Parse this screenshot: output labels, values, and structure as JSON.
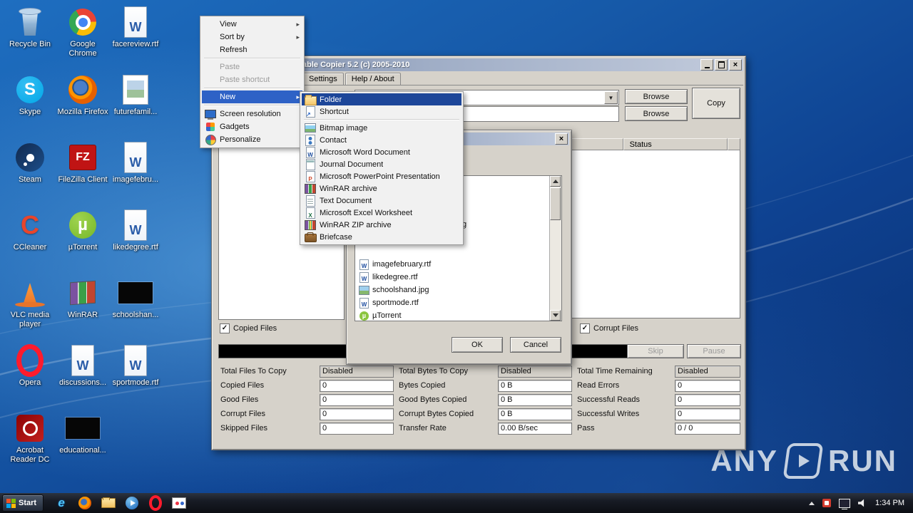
{
  "colors": {
    "selection_blue": "#2e62c6",
    "submenu_selection_blue": "#1d4699",
    "desktop_blue": "#1659a8",
    "window_gray": "#d6d2ca",
    "taskbar_dark": "#14161c"
  },
  "desktop": {
    "icons": [
      {
        "label": "Recycle Bin",
        "type": "recycle",
        "col": 0,
        "row": 0
      },
      {
        "label": "Google Chrome",
        "type": "chrome",
        "col": 1,
        "row": 0
      },
      {
        "label": "facereview.rtf",
        "type": "doc",
        "glyph": "W",
        "col": 2,
        "row": 0
      },
      {
        "label": "Skype",
        "type": "skype",
        "col": 0,
        "row": 1
      },
      {
        "label": "Mozilla Firefox",
        "type": "firefox",
        "col": 1,
        "row": 1
      },
      {
        "label": "futurefamil...",
        "type": "imgfile",
        "col": 2,
        "row": 1
      },
      {
        "label": "Steam",
        "type": "steam",
        "col": 0,
        "row": 2
      },
      {
        "label": "FileZilla Client",
        "type": "filezilla",
        "col": 1,
        "row": 2
      },
      {
        "label": "imagefebru...",
        "type": "doc",
        "glyph": "W",
        "col": 2,
        "row": 2
      },
      {
        "label": "CCleaner",
        "type": "ccleaner",
        "col": 0,
        "row": 3
      },
      {
        "label": "µTorrent",
        "type": "utorrent",
        "col": 1,
        "row": 3
      },
      {
        "label": "likedegree.rtf",
        "type": "doc",
        "glyph": "W",
        "col": 2,
        "row": 3
      },
      {
        "label": "VLC media player",
        "type": "vlc",
        "col": 0,
        "row": 4
      },
      {
        "label": "WinRAR",
        "type": "winrar",
        "col": 1,
        "row": 4
      },
      {
        "label": "schoolshan...",
        "type": "blackthumb",
        "col": 2,
        "row": 4
      },
      {
        "label": "Opera",
        "type": "opera",
        "col": 0,
        "row": 5
      },
      {
        "label": "discussions...",
        "type": "doc",
        "glyph": "W",
        "col": 1,
        "row": 5
      },
      {
        "label": "sportmode.rtf",
        "type": "doc",
        "glyph": "W",
        "col": 2,
        "row": 5
      },
      {
        "label": "Acrobat Reader DC",
        "type": "acrobat",
        "col": 0,
        "row": 6
      },
      {
        "label": "educational...",
        "type": "blackthumb",
        "col": 1,
        "row": 6
      }
    ]
  },
  "context_menu": {
    "items": [
      {
        "label": "View",
        "submenu": true
      },
      {
        "label": "Sort by",
        "submenu": true
      },
      {
        "label": "Refresh"
      },
      {
        "sep": true
      },
      {
        "label": "Paste",
        "disabled": true
      },
      {
        "label": "Paste shortcut",
        "disabled": true
      },
      {
        "sep": true
      },
      {
        "label": "New",
        "submenu": true,
        "selected": true
      },
      {
        "sep": true
      },
      {
        "label": "Screen resolution",
        "icon": "screen"
      },
      {
        "label": "Gadgets",
        "icon": "gadgets"
      },
      {
        "label": "Personalize",
        "icon": "personalize"
      }
    ]
  },
  "new_submenu": {
    "items": [
      {
        "label": "Folder",
        "icon": "folder",
        "selected": true
      },
      {
        "label": "Shortcut",
        "icon": "shortcut"
      },
      {
        "sep": true
      },
      {
        "label": "Bitmap image",
        "icon": "bitmap"
      },
      {
        "label": "Contact",
        "icon": "contact"
      },
      {
        "label": "Microsoft Word Document",
        "icon": "word",
        "glyph": "W"
      },
      {
        "label": "Journal Document",
        "icon": "journal"
      },
      {
        "label": "Microsoft PowerPoint Presentation",
        "icon": "powerpoint",
        "glyph": "P"
      },
      {
        "label": "WinRAR archive",
        "icon": "rar"
      },
      {
        "label": "Text Document",
        "icon": "text"
      },
      {
        "label": "Microsoft Excel Worksheet",
        "icon": "excel",
        "glyph": "X"
      },
      {
        "label": "WinRAR ZIP archive",
        "icon": "zip"
      },
      {
        "label": "Briefcase",
        "icon": "briefcase"
      }
    ]
  },
  "app_window": {
    "title": "able Copier 5.2 (c) 2005-2010",
    "tabs": [
      "Settings",
      "Help / About"
    ],
    "browse_top": "Browse",
    "browse_bottom": "Browse",
    "copy": "Copy",
    "status_column": "Status",
    "copied_files": "Copied Files",
    "corrupt_files": "Corrupt Files",
    "skip": "Skip",
    "pause": "Pause",
    "stats": {
      "files": [
        {
          "label": "Total Files To Copy",
          "value": "Disabled"
        },
        {
          "label": "Copied Files",
          "value": "0"
        },
        {
          "label": "Good Files",
          "value": "0"
        },
        {
          "label": "Corrupt Files",
          "value": "0"
        },
        {
          "label": "Skipped Files",
          "value": "0"
        }
      ],
      "bytes": [
        {
          "label": "Total Bytes To Copy",
          "value": "Disabled"
        },
        {
          "label": "Bytes Copied",
          "value": "0 B"
        },
        {
          "label": "Good Bytes Copied",
          "value": "0 B"
        },
        {
          "label": "Corrupt Bytes Copied",
          "value": "0 B"
        },
        {
          "label": "Transfer Rate",
          "value": "0.00 B/sec"
        }
      ],
      "time": [
        {
          "label": "Total Time Remaining",
          "value": "Disabled"
        },
        {
          "label": "Read Errors",
          "value": "0"
        },
        {
          "label": "Successful Reads",
          "value": "0"
        },
        {
          "label": "Successful Writes",
          "value": "0"
        },
        {
          "label": "Pass",
          "value": "0 / 0"
        }
      ]
    }
  },
  "dialog": {
    "partial_item_text": "g",
    "files": [
      {
        "name": "imagefebruary.rtf",
        "icon": "word"
      },
      {
        "name": "likedegree.rtf",
        "icon": "word"
      },
      {
        "name": "schoolshand.jpg",
        "icon": "image"
      },
      {
        "name": "sportmode.rtf",
        "icon": "word"
      },
      {
        "name": "µTorrent",
        "icon": "utorrent"
      }
    ],
    "ok": "OK",
    "cancel": "Cancel"
  },
  "taskbar": {
    "start_label": "Start",
    "clock": "1:34 PM"
  },
  "watermark": {
    "left": "ANY",
    "right": "RUN"
  }
}
